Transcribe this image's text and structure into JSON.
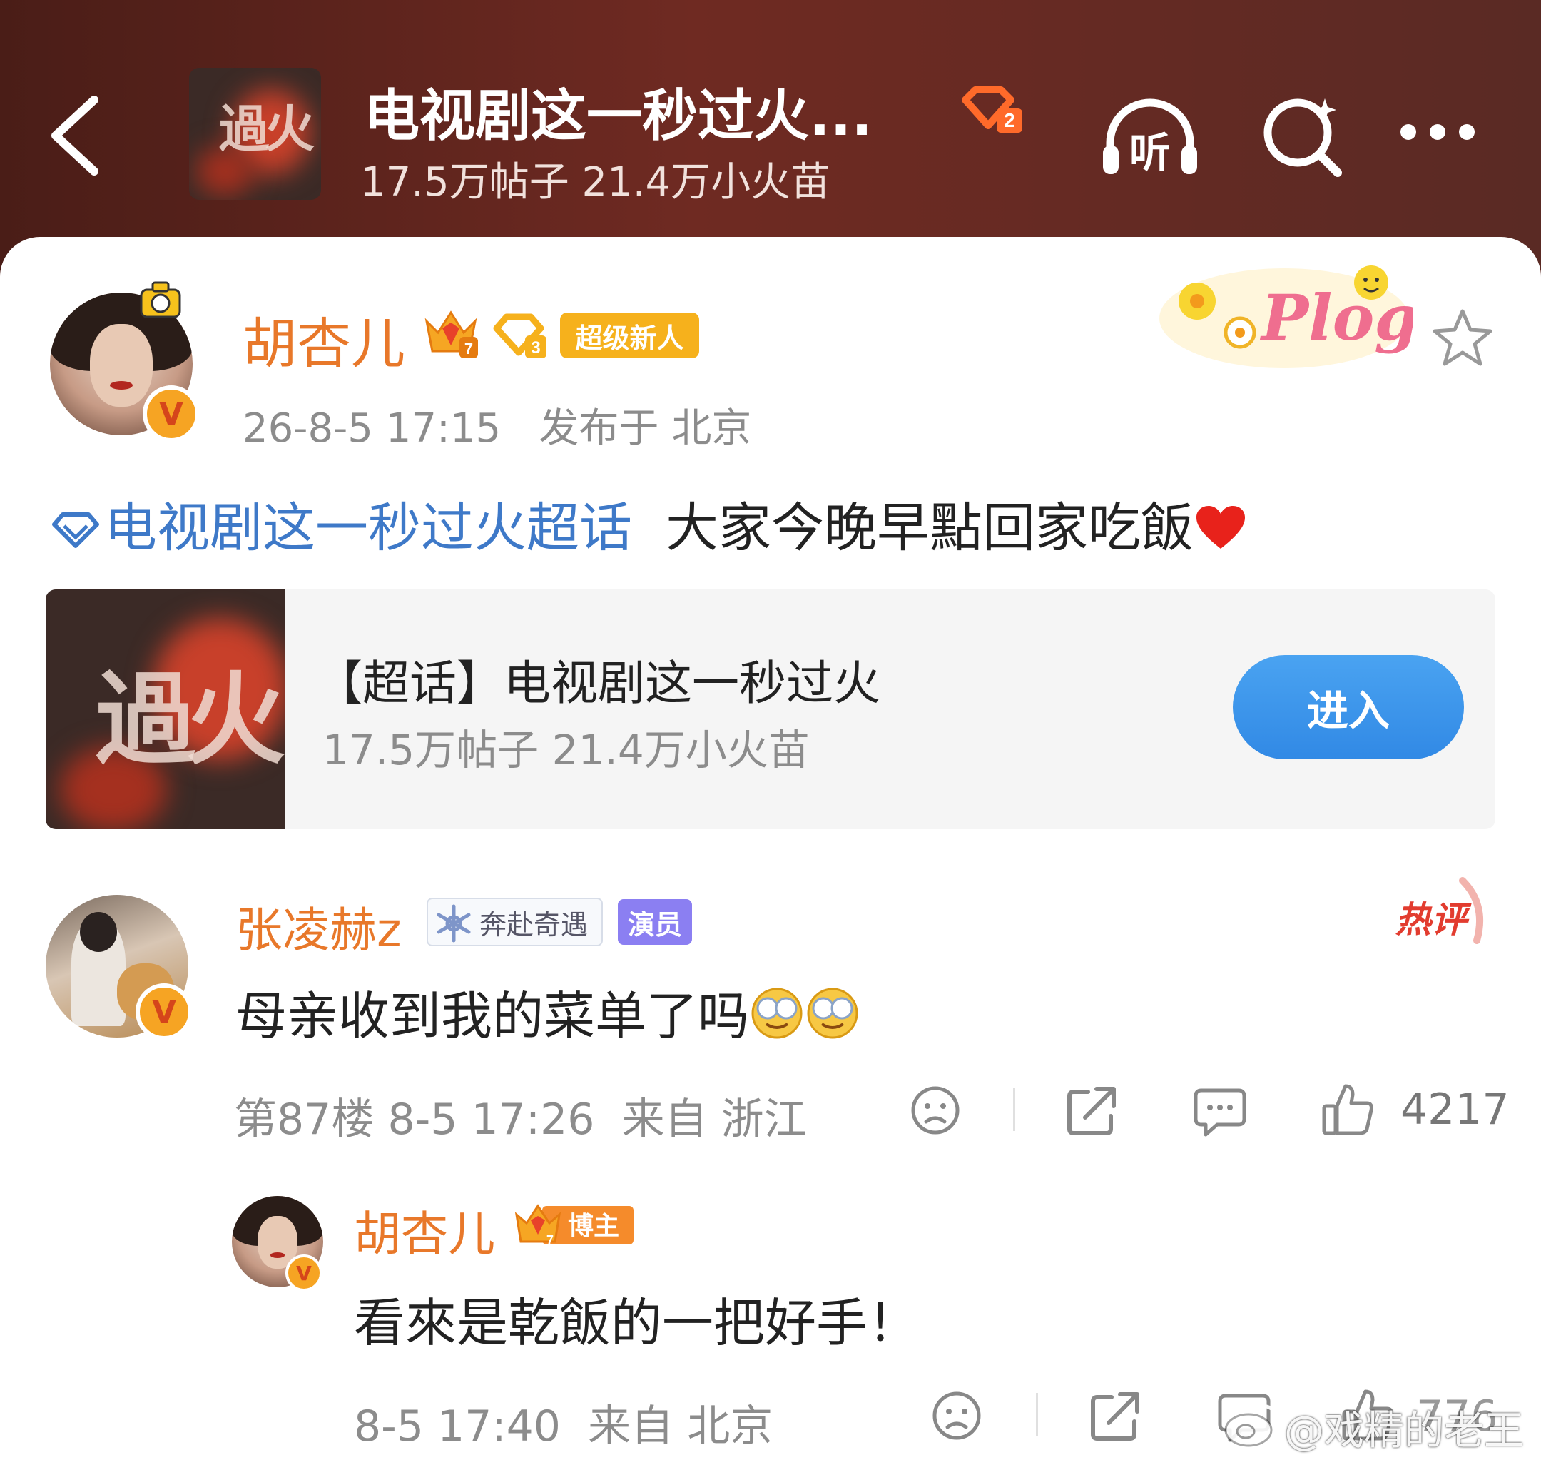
{
  "header": {
    "title": "电视剧这一秒过火...",
    "stats": "17.5万帖子 21.4万小火苗",
    "cover_text": "過火",
    "level": "2",
    "listen_label": "听"
  },
  "post": {
    "author": "胡杏儿",
    "crown_level": "7",
    "level": "3",
    "tag": "超级新人",
    "time": "26-8-5 17:15",
    "location": "发布于 北京",
    "sticker_text": "Plog",
    "topic": "电视剧这一秒过火超话",
    "text": "大家今晚早點回家吃飯"
  },
  "topic_card": {
    "cover_text": "過火",
    "title": "【超话】电视剧这一秒过火",
    "stats": "17.5万帖子 21.4万小火苗",
    "enter_label": "进入"
  },
  "comment": {
    "author": "张凌赫z",
    "fan_badge": "奔赴奇遇",
    "role_badge": "演员",
    "hot_label": "热评",
    "text": "母亲收到我的菜单了吗",
    "floor": "第87楼",
    "time": "8-5 17:26",
    "location": "来自 浙江",
    "likes": "4217"
  },
  "reply": {
    "author": "胡杏儿",
    "crown_level": "7",
    "host_badge": "博主",
    "text": "看來是乾飯的一把好手！",
    "time": "8-5 17:40",
    "location": "来自 北京",
    "likes": "776"
  },
  "watermark": "@戏精的老王",
  "colors": {
    "header_bg": "#6f2a22",
    "name_orange": "#e8782a",
    "topic_blue": "#3e79c8",
    "enter_blue": "#3189e5",
    "meta_gray": "#8c8c8c"
  }
}
